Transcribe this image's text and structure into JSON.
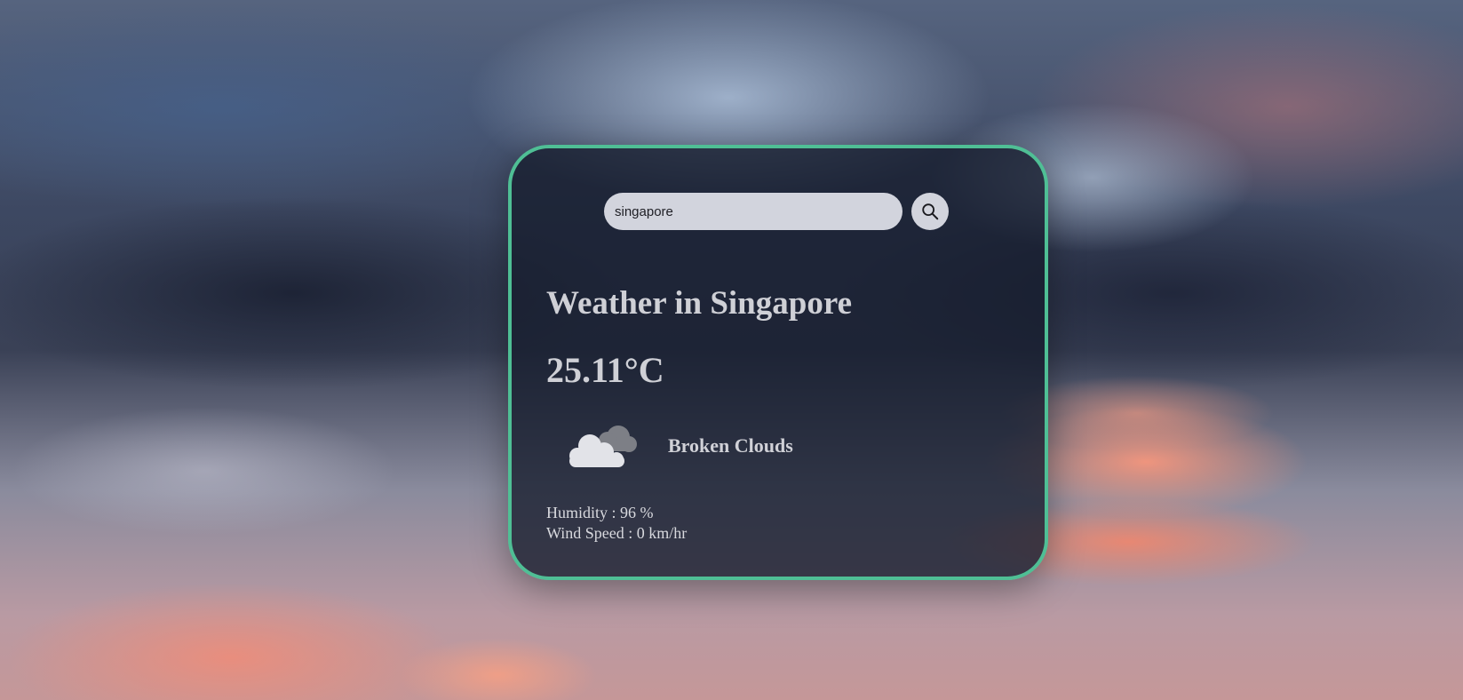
{
  "search": {
    "value": "singapore",
    "button_icon": "search-icon"
  },
  "weather": {
    "title": "Weather in Singapore",
    "temperature": "25.11°C",
    "condition_icon": "broken-clouds-icon",
    "condition": "Broken Clouds",
    "humidity": "Humidity : 96 %",
    "wind_speed": "Wind Speed : 0 km/hr"
  },
  "colors": {
    "card_border": "#4fbf95",
    "card_background": "#161c2d",
    "input_background": "#d2d4dd",
    "text": "#cfd0d6"
  }
}
